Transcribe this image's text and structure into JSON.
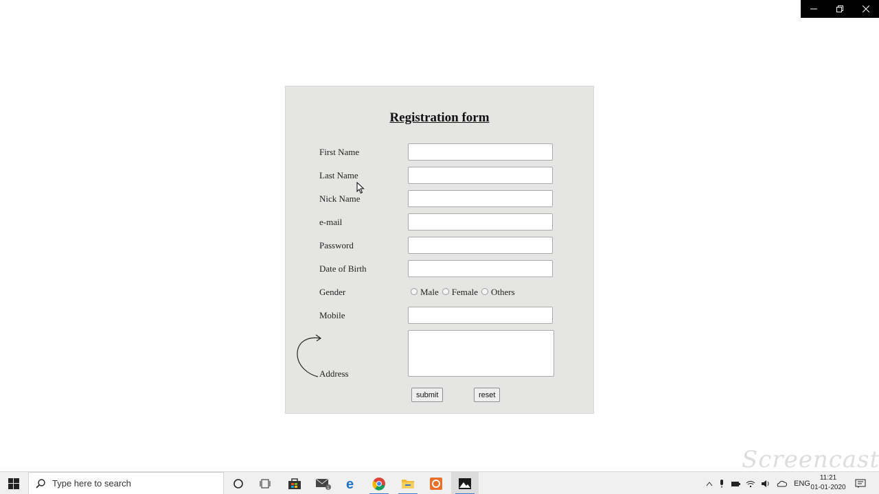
{
  "window": {
    "minimize_icon": "minimize-icon",
    "restore_icon": "restore-icon",
    "close_icon": "close-icon"
  },
  "form": {
    "title": "Registration form",
    "fields": [
      {
        "label": "First Name",
        "value": ""
      },
      {
        "label": "Last Name",
        "value": ""
      },
      {
        "label": "Nick Name",
        "value": ""
      },
      {
        "label": "e-mail",
        "value": ""
      },
      {
        "label": "Password",
        "value": ""
      },
      {
        "label": "Date of Birth",
        "value": ""
      }
    ],
    "gender": {
      "label": "Gender",
      "options": [
        "Male",
        "Female",
        "Others"
      ]
    },
    "mobile": {
      "label": "Mobile",
      "value": ""
    },
    "address": {
      "label": "Address",
      "value": ""
    },
    "submit_label": "submit",
    "reset_label": "reset"
  },
  "taskbar": {
    "search_placeholder": "Type here to search",
    "apps": [
      "task-view-icon",
      "store-icon",
      "mail-icon",
      "edge-icon",
      "chrome-icon",
      "file-explorer-icon",
      "screen-recorder-icon",
      "photos-icon"
    ],
    "tray_language": "ENG",
    "time": "11:21",
    "date": "01-01-2020",
    "accent": "#3a78c8"
  },
  "watermark": "Screencast"
}
